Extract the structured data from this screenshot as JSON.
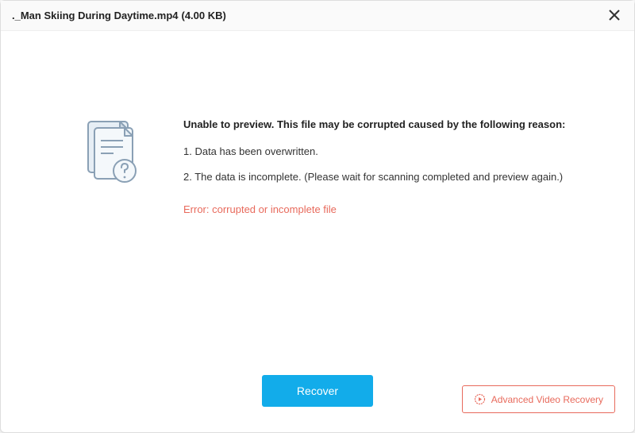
{
  "titlebar": {
    "filename": "._Man Skiing During Daytime.mp4",
    "filesize": "(4.00  KB)"
  },
  "message": {
    "headline": "Unable to preview. This file may be corrupted caused by the following reason:",
    "reason1": "1. Data has been overwritten.",
    "reason2": "2. The data is incomplete. (Please wait for scanning completed and preview again.)",
    "error": "Error: corrupted or incomplete file"
  },
  "footer": {
    "recover_label": "Recover",
    "advanced_label": "Advanced Video Recovery"
  }
}
